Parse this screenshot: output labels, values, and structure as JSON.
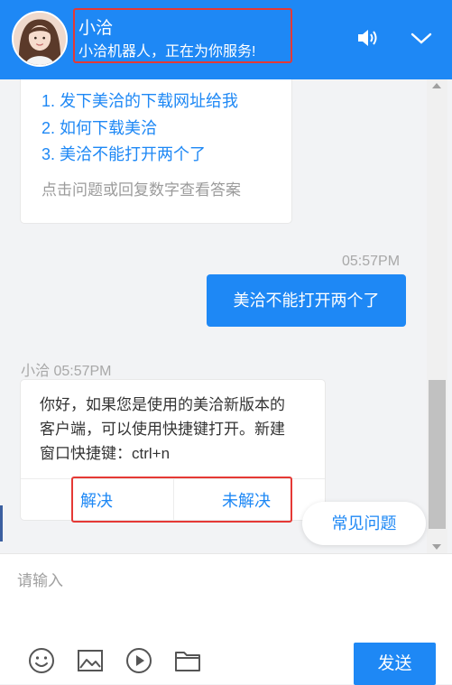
{
  "header": {
    "agent_name": "小洽",
    "agent_status": "小洽机器人，正在为你服务!",
    "icons": [
      "avatar",
      "volume-icon",
      "chevron-down-icon"
    ]
  },
  "faq_card": {
    "items": [
      "1. 发下美洽的下载网址给我",
      "2. 如何下载美洽",
      "3. 美洽不能打开两个了"
    ],
    "hint": "点击问题或回复数字查看答案"
  },
  "user_message": {
    "time": "05:57PM",
    "text": "美洽不能打开两个了"
  },
  "bot_reply": {
    "meta": "小洽 05:57PM",
    "text": "你好，如果您是使用的美洽新版本的客户端，可以使用快捷键打开。新建窗口快捷键：ctrl+n",
    "resolved_label": "解决",
    "unresolved_label": "未解决"
  },
  "faq_button": "常见问题",
  "composer": {
    "placeholder": "请输入",
    "tools": [
      "emoji-icon",
      "image-icon",
      "video-icon",
      "folder-icon"
    ],
    "send_label": "发送"
  },
  "colors": {
    "brand": "#1e88f5",
    "highlight_box": "#e53935"
  }
}
